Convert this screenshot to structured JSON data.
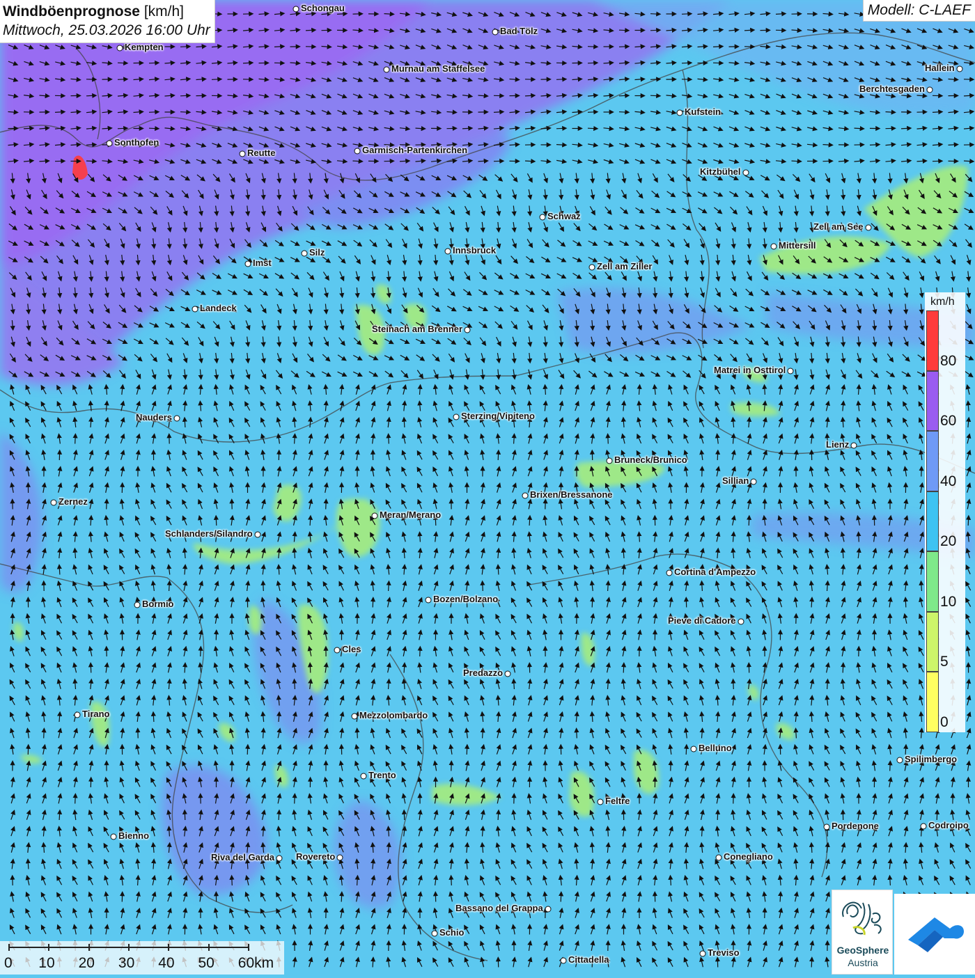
{
  "header": {
    "title_bold": "Windböenprognose",
    "title_unit": "[km/h]",
    "datetime": "Mittwoch, 25.03.2026 16:00 Uhr",
    "model": "Modell: C-LAEF"
  },
  "legend": {
    "unit": "km/h",
    "classes": [
      {
        "label": "80",
        "color": "#ff3b3b"
      },
      {
        "label": "60",
        "color": "#9a5cf0"
      },
      {
        "label": "40",
        "color": "#6f9af6"
      },
      {
        "label": "20",
        "color": "#3ec3f2"
      },
      {
        "label": "10",
        "color": "#7fe98a"
      },
      {
        "label": "5",
        "color": "#cdf56a"
      },
      {
        "label": "0",
        "color": "#ffff60"
      }
    ]
  },
  "scale_bar": {
    "labels": [
      "0",
      "10",
      "20",
      "30",
      "40",
      "50",
      "60km"
    ]
  },
  "cities": [
    {
      "name": "Schongau"
    },
    {
      "name": "Bad Tölz"
    },
    {
      "name": "Kempten"
    },
    {
      "name": "Murnau am Staffelsee"
    },
    {
      "name": "Hallein"
    },
    {
      "name": "Berchtesgaden"
    },
    {
      "name": "Kufstein"
    },
    {
      "name": "Sonthofen"
    },
    {
      "name": "Reutte"
    },
    {
      "name": "Garmisch-Partenkirchen"
    },
    {
      "name": "Kitzbühel"
    },
    {
      "name": "Schwaz"
    },
    {
      "name": "Zell am See"
    },
    {
      "name": "Mittersill"
    },
    {
      "name": "Innsbruck"
    },
    {
      "name": "Silz"
    },
    {
      "name": "Imst"
    },
    {
      "name": "Zell am Ziller"
    },
    {
      "name": "Landeck"
    },
    {
      "name": "Steinach am Brenner"
    },
    {
      "name": "Matrei in Osttirol"
    },
    {
      "name": "Nauders"
    },
    {
      "name": "Sterzing/Vipiteno"
    },
    {
      "name": "Lienz"
    },
    {
      "name": "Bruneck/Brunico"
    },
    {
      "name": "Sillian"
    },
    {
      "name": "Brixen/Bressanone"
    },
    {
      "name": "Zernez"
    },
    {
      "name": "Meran/Merano"
    },
    {
      "name": "Schlanders/Silandro"
    },
    {
      "name": "Cortina d'Ampezzo"
    },
    {
      "name": "Bozen/Bolzano"
    },
    {
      "name": "Bormio"
    },
    {
      "name": "Pieve di Cadore"
    },
    {
      "name": "Cles"
    },
    {
      "name": "Predazzo"
    },
    {
      "name": "Tirano"
    },
    {
      "name": "Mezzolombardo"
    },
    {
      "name": "Belluno"
    },
    {
      "name": "Spilimbergo"
    },
    {
      "name": "Trento"
    },
    {
      "name": "Feltre"
    },
    {
      "name": "Bienno"
    },
    {
      "name": "Pordenone"
    },
    {
      "name": "Codroipo"
    },
    {
      "name": "Riva del Garda"
    },
    {
      "name": "Rovereto"
    },
    {
      "name": "Conegliano"
    },
    {
      "name": "Bassano del Grappa"
    },
    {
      "name": "Schio"
    },
    {
      "name": "Treviso"
    },
    {
      "name": "Cittadella"
    }
  ],
  "logos": {
    "geosphere_name": "GeoSphere",
    "geosphere_sub": "Austria",
    "geosphere_icon": "geosphere-logo-icon",
    "partner_icon": "cloud-arrow-logo-icon"
  }
}
